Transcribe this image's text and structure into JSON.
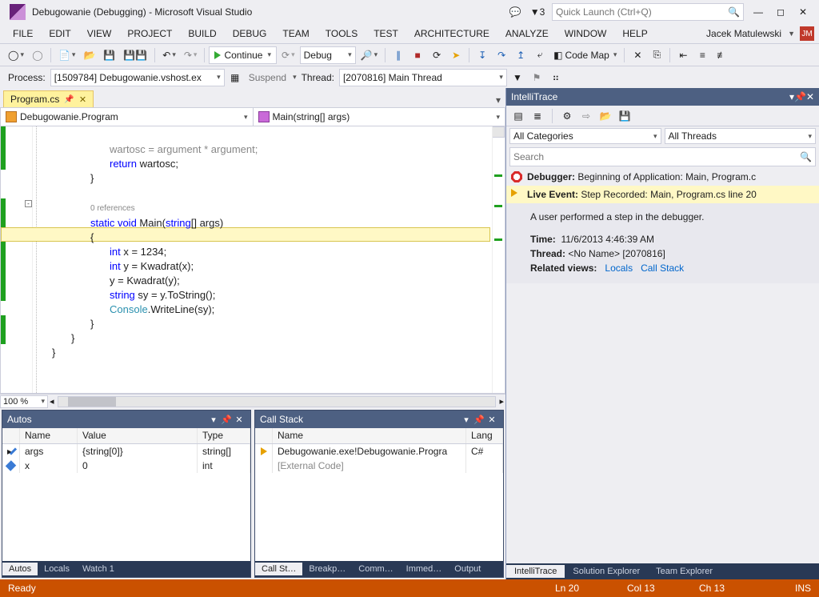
{
  "title": "Debugowanie (Debugging) - Microsoft Visual Studio",
  "quicklaunch_placeholder": "Quick Launch (Ctrl+Q)",
  "notif_count": "3",
  "menu": [
    "FILE",
    "EDIT",
    "VIEW",
    "PROJECT",
    "BUILD",
    "DEBUG",
    "TEAM",
    "TOOLS",
    "TEST",
    "ARCHITECTURE",
    "ANALYZE",
    "WINDOW",
    "HELP"
  ],
  "user": {
    "name": "Jacek Matulewski",
    "initials": "JM"
  },
  "toolbar1": {
    "continue": "Continue",
    "config": "Debug",
    "codemap": "Code Map"
  },
  "toolbar2": {
    "process_label": "Process:",
    "process_value": "[1509784] Debugowanie.vshost.ex",
    "suspend": "Suspend",
    "thread_label": "Thread:",
    "thread_value": "[2070816] Main Thread"
  },
  "doc_tab": "Program.cs",
  "navbar_left": "Debugowanie.Program",
  "navbar_right": "Main(string[] args)",
  "code": {
    "ref": "0 references",
    "l1a": "wartosc = argument * argument;",
    "l2a": "return",
    "l2b": " wartosc;",
    "l3": "}",
    "l5a": "static void",
    "l5b": " Main(",
    "l5c": "string",
    "l5d": "[] args)",
    "l6": "{",
    "l7a": "int",
    "l7b": " x = 1234;",
    "l8a": "int",
    "l8b": " y = Kwadrat(x);",
    "l9": "y = Kwadrat(y);",
    "l10a": "string",
    "l10b": " sy = y.ToString();",
    "l11a": "Console",
    "l11b": ".WriteLine(sy);",
    "l12": "}",
    "l13": "}",
    "l14": "}"
  },
  "zoom": "100 %",
  "autos": {
    "title": "Autos",
    "cols": [
      "Name",
      "Value",
      "Type"
    ],
    "rows": [
      {
        "name": "args",
        "value": "{string[0]}",
        "type": "string[]"
      },
      {
        "name": "x",
        "value": "0",
        "type": "int"
      }
    ],
    "tabs": [
      "Autos",
      "Locals",
      "Watch 1"
    ]
  },
  "callstack": {
    "title": "Call Stack",
    "cols": [
      "Name",
      "Lang"
    ],
    "rows": [
      {
        "name": "Debugowanie.exe!Debugowanie.Progra",
        "lang": "C#"
      },
      {
        "name": "[External Code]",
        "lang": ""
      }
    ],
    "tabs": [
      "Call St…",
      "Breakp…",
      "Comm…",
      "Immed…",
      "Output"
    ]
  },
  "intellitrace": {
    "title": "IntelliTrace",
    "filter_cat": "All Categories",
    "filter_thr": "All Threads",
    "search_placeholder": "Search",
    "events": [
      {
        "kind": "debugger",
        "label": "Debugger:",
        "text": "Beginning of Application: Main, Program.c"
      },
      {
        "kind": "live",
        "label": "Live Event:",
        "text": "Step Recorded: Main, Program.cs line 20"
      }
    ],
    "detail": {
      "desc": "A user performed a step in the debugger.",
      "time_label": "Time:",
      "time": "11/6/2013 4:46:39 AM",
      "thread_label": "Thread:",
      "thread": "<No Name> [2070816]",
      "related_label": "Related views:",
      "link1": "Locals",
      "link2": "Call Stack"
    },
    "tabs": [
      "IntelliTrace",
      "Solution Explorer",
      "Team Explorer"
    ]
  },
  "status": {
    "ready": "Ready",
    "ln": "Ln 20",
    "col": "Col 13",
    "ch": "Ch 13",
    "ins": "INS"
  }
}
